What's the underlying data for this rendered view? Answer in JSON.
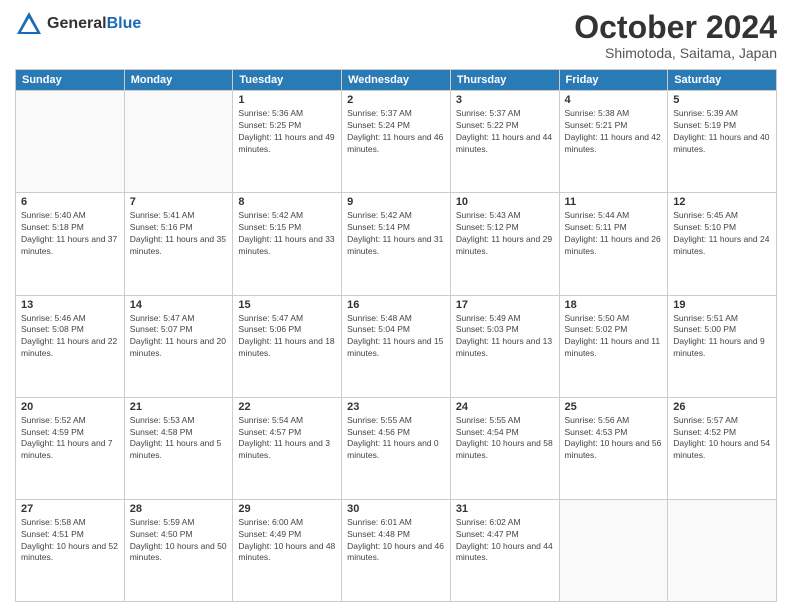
{
  "header": {
    "logo_line1": "General",
    "logo_line2": "Blue",
    "month_title": "October 2024",
    "location": "Shimotoda, Saitama, Japan"
  },
  "days_of_week": [
    "Sunday",
    "Monday",
    "Tuesday",
    "Wednesday",
    "Thursday",
    "Friday",
    "Saturday"
  ],
  "weeks": [
    [
      {
        "day": "",
        "empty": true
      },
      {
        "day": "",
        "empty": true
      },
      {
        "day": "1",
        "sunrise": "Sunrise: 5:36 AM",
        "sunset": "Sunset: 5:25 PM",
        "daylight": "Daylight: 11 hours and 49 minutes."
      },
      {
        "day": "2",
        "sunrise": "Sunrise: 5:37 AM",
        "sunset": "Sunset: 5:24 PM",
        "daylight": "Daylight: 11 hours and 46 minutes."
      },
      {
        "day": "3",
        "sunrise": "Sunrise: 5:37 AM",
        "sunset": "Sunset: 5:22 PM",
        "daylight": "Daylight: 11 hours and 44 minutes."
      },
      {
        "day": "4",
        "sunrise": "Sunrise: 5:38 AM",
        "sunset": "Sunset: 5:21 PM",
        "daylight": "Daylight: 11 hours and 42 minutes."
      },
      {
        "day": "5",
        "sunrise": "Sunrise: 5:39 AM",
        "sunset": "Sunset: 5:19 PM",
        "daylight": "Daylight: 11 hours and 40 minutes."
      }
    ],
    [
      {
        "day": "6",
        "sunrise": "Sunrise: 5:40 AM",
        "sunset": "Sunset: 5:18 PM",
        "daylight": "Daylight: 11 hours and 37 minutes."
      },
      {
        "day": "7",
        "sunrise": "Sunrise: 5:41 AM",
        "sunset": "Sunset: 5:16 PM",
        "daylight": "Daylight: 11 hours and 35 minutes."
      },
      {
        "day": "8",
        "sunrise": "Sunrise: 5:42 AM",
        "sunset": "Sunset: 5:15 PM",
        "daylight": "Daylight: 11 hours and 33 minutes."
      },
      {
        "day": "9",
        "sunrise": "Sunrise: 5:42 AM",
        "sunset": "Sunset: 5:14 PM",
        "daylight": "Daylight: 11 hours and 31 minutes."
      },
      {
        "day": "10",
        "sunrise": "Sunrise: 5:43 AM",
        "sunset": "Sunset: 5:12 PM",
        "daylight": "Daylight: 11 hours and 29 minutes."
      },
      {
        "day": "11",
        "sunrise": "Sunrise: 5:44 AM",
        "sunset": "Sunset: 5:11 PM",
        "daylight": "Daylight: 11 hours and 26 minutes."
      },
      {
        "day": "12",
        "sunrise": "Sunrise: 5:45 AM",
        "sunset": "Sunset: 5:10 PM",
        "daylight": "Daylight: 11 hours and 24 minutes."
      }
    ],
    [
      {
        "day": "13",
        "sunrise": "Sunrise: 5:46 AM",
        "sunset": "Sunset: 5:08 PM",
        "daylight": "Daylight: 11 hours and 22 minutes."
      },
      {
        "day": "14",
        "sunrise": "Sunrise: 5:47 AM",
        "sunset": "Sunset: 5:07 PM",
        "daylight": "Daylight: 11 hours and 20 minutes."
      },
      {
        "day": "15",
        "sunrise": "Sunrise: 5:47 AM",
        "sunset": "Sunset: 5:06 PM",
        "daylight": "Daylight: 11 hours and 18 minutes."
      },
      {
        "day": "16",
        "sunrise": "Sunrise: 5:48 AM",
        "sunset": "Sunset: 5:04 PM",
        "daylight": "Daylight: 11 hours and 15 minutes."
      },
      {
        "day": "17",
        "sunrise": "Sunrise: 5:49 AM",
        "sunset": "Sunset: 5:03 PM",
        "daylight": "Daylight: 11 hours and 13 minutes."
      },
      {
        "day": "18",
        "sunrise": "Sunrise: 5:50 AM",
        "sunset": "Sunset: 5:02 PM",
        "daylight": "Daylight: 11 hours and 11 minutes."
      },
      {
        "day": "19",
        "sunrise": "Sunrise: 5:51 AM",
        "sunset": "Sunset: 5:00 PM",
        "daylight": "Daylight: 11 hours and 9 minutes."
      }
    ],
    [
      {
        "day": "20",
        "sunrise": "Sunrise: 5:52 AM",
        "sunset": "Sunset: 4:59 PM",
        "daylight": "Daylight: 11 hours and 7 minutes."
      },
      {
        "day": "21",
        "sunrise": "Sunrise: 5:53 AM",
        "sunset": "Sunset: 4:58 PM",
        "daylight": "Daylight: 11 hours and 5 minutes."
      },
      {
        "day": "22",
        "sunrise": "Sunrise: 5:54 AM",
        "sunset": "Sunset: 4:57 PM",
        "daylight": "Daylight: 11 hours and 3 minutes."
      },
      {
        "day": "23",
        "sunrise": "Sunrise: 5:55 AM",
        "sunset": "Sunset: 4:56 PM",
        "daylight": "Daylight: 11 hours and 0 minutes."
      },
      {
        "day": "24",
        "sunrise": "Sunrise: 5:55 AM",
        "sunset": "Sunset: 4:54 PM",
        "daylight": "Daylight: 10 hours and 58 minutes."
      },
      {
        "day": "25",
        "sunrise": "Sunrise: 5:56 AM",
        "sunset": "Sunset: 4:53 PM",
        "daylight": "Daylight: 10 hours and 56 minutes."
      },
      {
        "day": "26",
        "sunrise": "Sunrise: 5:57 AM",
        "sunset": "Sunset: 4:52 PM",
        "daylight": "Daylight: 10 hours and 54 minutes."
      }
    ],
    [
      {
        "day": "27",
        "sunrise": "Sunrise: 5:58 AM",
        "sunset": "Sunset: 4:51 PM",
        "daylight": "Daylight: 10 hours and 52 minutes."
      },
      {
        "day": "28",
        "sunrise": "Sunrise: 5:59 AM",
        "sunset": "Sunset: 4:50 PM",
        "daylight": "Daylight: 10 hours and 50 minutes."
      },
      {
        "day": "29",
        "sunrise": "Sunrise: 6:00 AM",
        "sunset": "Sunset: 4:49 PM",
        "daylight": "Daylight: 10 hours and 48 minutes."
      },
      {
        "day": "30",
        "sunrise": "Sunrise: 6:01 AM",
        "sunset": "Sunset: 4:48 PM",
        "daylight": "Daylight: 10 hours and 46 minutes."
      },
      {
        "day": "31",
        "sunrise": "Sunrise: 6:02 AM",
        "sunset": "Sunset: 4:47 PM",
        "daylight": "Daylight: 10 hours and 44 minutes."
      },
      {
        "day": "",
        "empty": true
      },
      {
        "day": "",
        "empty": true
      }
    ]
  ]
}
